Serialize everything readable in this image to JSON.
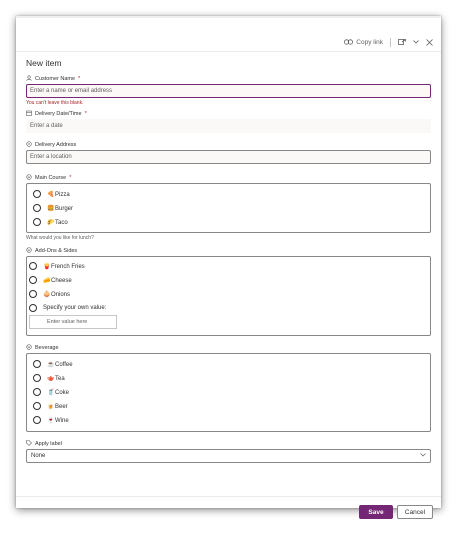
{
  "topbar": {
    "copy_link": "Copy link"
  },
  "title": "New item",
  "customer_name": {
    "label": "Customer Name",
    "required": "*",
    "placeholder": "Enter a name or email address",
    "error": "You can't leave this blank."
  },
  "delivery_datetime": {
    "label": "Delivery Date/Time",
    "required": "*",
    "placeholder": "Enter a date"
  },
  "delivery_address": {
    "label": "Delivery Address",
    "placeholder": "Enter a location"
  },
  "main_course": {
    "label": "Main Course",
    "required": "*",
    "options": [
      {
        "emoji": "🍕",
        "label": "Pizza"
      },
      {
        "emoji": "🍔",
        "label": "Burger"
      },
      {
        "emoji": "🌮",
        "label": "Taco"
      }
    ],
    "hint": "What would you like for lunch?"
  },
  "addons": {
    "label": "Add-Ons & Sides",
    "options": [
      {
        "emoji": "🍟",
        "label": "French Fries"
      },
      {
        "emoji": "🧀",
        "label": "Cheese"
      },
      {
        "emoji": "🧅",
        "label": "Onions"
      }
    ],
    "custom_label": "Specify your own value:",
    "custom_placeholder": "Enter value here"
  },
  "beverage": {
    "label": "Beverage",
    "options": [
      {
        "emoji": "☕",
        "label": "Coffee"
      },
      {
        "emoji": "🫖",
        "label": "Tea"
      },
      {
        "emoji": "🥤",
        "label": "Coke"
      },
      {
        "emoji": "🍺",
        "label": "Beer"
      },
      {
        "emoji": "🍷",
        "label": "Wine"
      }
    ]
  },
  "apply_label": {
    "label": "Apply label",
    "value": "None"
  },
  "footer": {
    "save": "Save",
    "cancel": "Cancel"
  },
  "colors": {
    "accent": "#742774",
    "error": "#a4262c"
  }
}
